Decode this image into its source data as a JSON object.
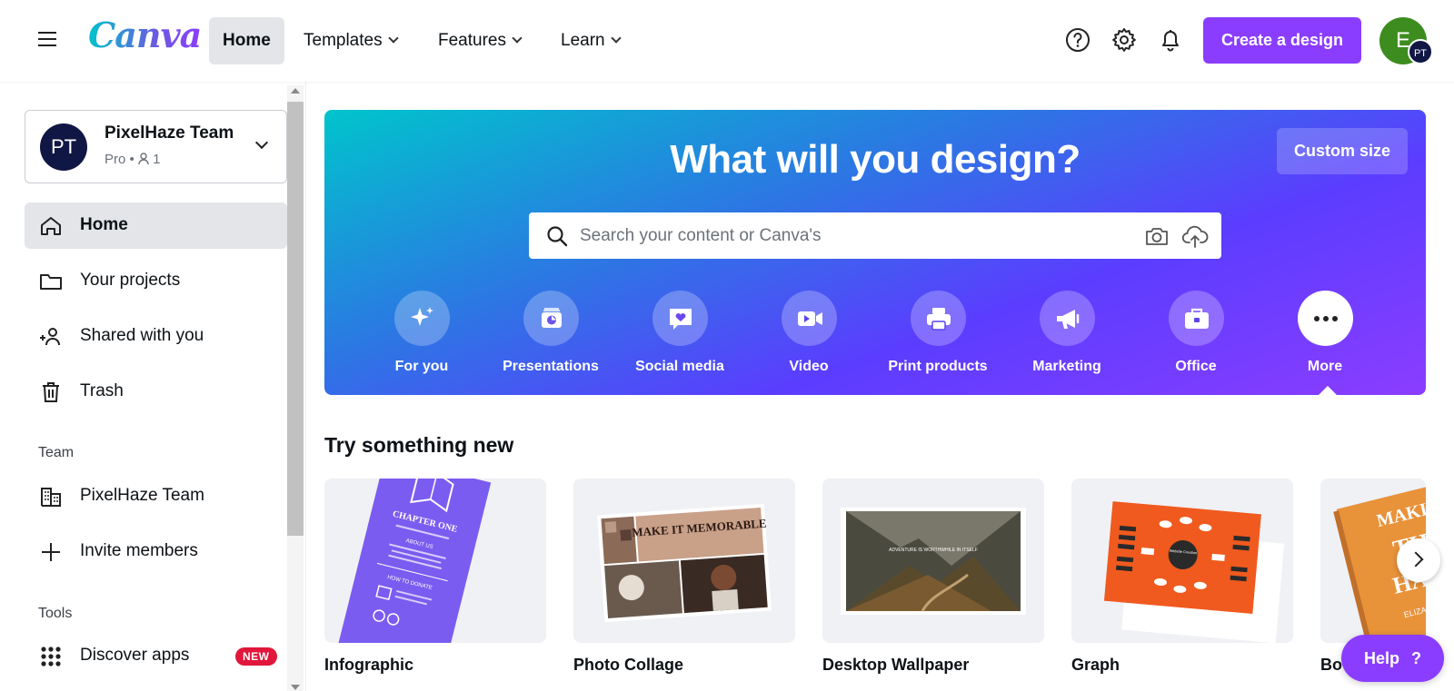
{
  "app": {
    "logo_text": "Canva",
    "brand_color": "#8b3dff"
  },
  "topnav": {
    "home": "Home",
    "templates": "Templates",
    "features": "Features",
    "learn": "Learn",
    "create_button": "Create a design",
    "avatar_initial": "E",
    "avatar_team_initials": "PT"
  },
  "sidebar": {
    "team_card": {
      "initials": "PT",
      "name": "PixelHaze Team",
      "plan": "Pro",
      "members": "1"
    },
    "items": [
      {
        "label": "Home",
        "icon": "home-icon"
      },
      {
        "label": "Your projects",
        "icon": "folder-icon"
      },
      {
        "label": "Shared with you",
        "icon": "shared-users-icon"
      },
      {
        "label": "Trash",
        "icon": "trash-icon"
      }
    ],
    "team_section": "Team",
    "team_items": [
      {
        "label": "PixelHaze Team",
        "icon": "building-icon"
      },
      {
        "label": "Invite members",
        "icon": "plus-icon"
      }
    ],
    "tools_section": "Tools",
    "tools_items": [
      {
        "label": "Discover apps",
        "icon": "apps-grid-icon",
        "badge": "NEW"
      }
    ]
  },
  "hero": {
    "title": "What will you design?",
    "custom_size": "Custom size",
    "search_placeholder": "Search your content or Canva's",
    "categories": [
      {
        "label": "For you",
        "icon": "sparkle-icon"
      },
      {
        "label": "Presentations",
        "icon": "presentation-icon"
      },
      {
        "label": "Social media",
        "icon": "heart-chat-icon"
      },
      {
        "label": "Video",
        "icon": "video-camera-icon"
      },
      {
        "label": "Print products",
        "icon": "printer-icon"
      },
      {
        "label": "Marketing",
        "icon": "megaphone-icon"
      },
      {
        "label": "Office",
        "icon": "briefcase-icon"
      },
      {
        "label": "More",
        "icon": "more-dots-icon"
      }
    ]
  },
  "try_new": {
    "title": "Try something new",
    "tiles": [
      {
        "label": "Infographic",
        "thumb_text_1": "CHAPTER ONE",
        "thumb_text_2": "ABOUT US",
        "thumb_text_3": "HOW TO DONATE"
      },
      {
        "label": "Photo Collage",
        "thumb_text": "MAKE IT MEMORABLE"
      },
      {
        "label": "Desktop Wallpaper",
        "thumb_text": "ADVENTURE IS WORTHWHILE IN ITSELF"
      },
      {
        "label": "Graph",
        "thumb_text": "Website Creation"
      },
      {
        "label": "Bo",
        "thumb_text_1": "MAKING",
        "thumb_text_2": "TH",
        "thumb_text_3": "HAPP",
        "thumb_text_4": "ELIZABETH"
      }
    ]
  },
  "help": {
    "label": "Help",
    "glyph": "?"
  }
}
